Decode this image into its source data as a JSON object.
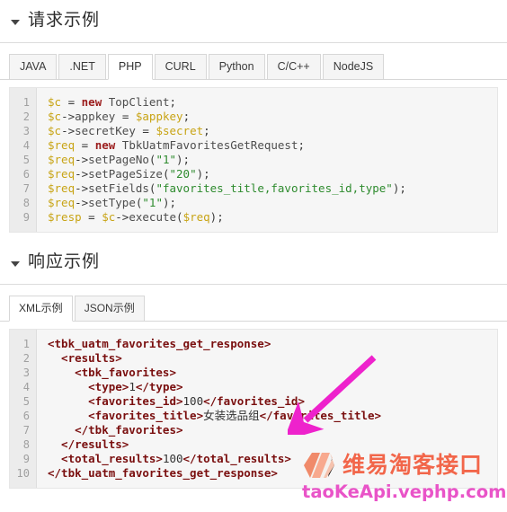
{
  "request_section": {
    "title": "请求示例",
    "caret_icon": "caret-down-icon",
    "tabs": [
      {
        "label": "JAVA",
        "active": false
      },
      {
        "label": ".NET",
        "active": false
      },
      {
        "label": "PHP",
        "active": true
      },
      {
        "label": "CURL",
        "active": false
      },
      {
        "label": "Python",
        "active": false
      },
      {
        "label": "C/C++",
        "active": false
      },
      {
        "label": "NodeJS",
        "active": false
      }
    ],
    "code": {
      "language": "php",
      "line_numbers": [
        "1",
        "2",
        "3",
        "4",
        "5",
        "6",
        "7",
        "8",
        "9"
      ],
      "lines": [
        [
          {
            "t": "$c ",
            "c": "v"
          },
          {
            "t": "= ",
            "c": "pn"
          },
          {
            "t": "new",
            "c": "kw"
          },
          {
            "t": " TopClient",
            "c": "cl"
          },
          {
            "t": ";",
            "c": "pn"
          }
        ],
        [
          {
            "t": "$c",
            "c": "v"
          },
          {
            "t": "->",
            "c": "pn"
          },
          {
            "t": "appkey ",
            "c": "cl"
          },
          {
            "t": "= ",
            "c": "pn"
          },
          {
            "t": "$appkey",
            "c": "v"
          },
          {
            "t": ";",
            "c": "pn"
          }
        ],
        [
          {
            "t": "$c",
            "c": "v"
          },
          {
            "t": "->",
            "c": "pn"
          },
          {
            "t": "secretKey ",
            "c": "cl"
          },
          {
            "t": "= ",
            "c": "pn"
          },
          {
            "t": "$secret",
            "c": "v"
          },
          {
            "t": ";",
            "c": "pn"
          }
        ],
        [
          {
            "t": "$req ",
            "c": "v"
          },
          {
            "t": "= ",
            "c": "pn"
          },
          {
            "t": "new",
            "c": "kw"
          },
          {
            "t": " TbkUatmFavoritesGetRequest",
            "c": "cl"
          },
          {
            "t": ";",
            "c": "pn"
          }
        ],
        [
          {
            "t": "$req",
            "c": "v"
          },
          {
            "t": "->",
            "c": "pn"
          },
          {
            "t": "setPageNo",
            "c": "cl"
          },
          {
            "t": "(",
            "c": "pn"
          },
          {
            "t": "\"1\"",
            "c": "st"
          },
          {
            "t": ");",
            "c": "pn"
          }
        ],
        [
          {
            "t": "$req",
            "c": "v"
          },
          {
            "t": "->",
            "c": "pn"
          },
          {
            "t": "setPageSize",
            "c": "cl"
          },
          {
            "t": "(",
            "c": "pn"
          },
          {
            "t": "\"20\"",
            "c": "st"
          },
          {
            "t": ");",
            "c": "pn"
          }
        ],
        [
          {
            "t": "$req",
            "c": "v"
          },
          {
            "t": "->",
            "c": "pn"
          },
          {
            "t": "setFields",
            "c": "cl"
          },
          {
            "t": "(",
            "c": "pn"
          },
          {
            "t": "\"favorites_title,favorites_id,type\"",
            "c": "st"
          },
          {
            "t": ");",
            "c": "pn"
          }
        ],
        [
          {
            "t": "$req",
            "c": "v"
          },
          {
            "t": "->",
            "c": "pn"
          },
          {
            "t": "setType",
            "c": "cl"
          },
          {
            "t": "(",
            "c": "pn"
          },
          {
            "t": "\"1\"",
            "c": "st"
          },
          {
            "t": ");",
            "c": "pn"
          }
        ],
        [
          {
            "t": "$resp ",
            "c": "v"
          },
          {
            "t": "= ",
            "c": "pn"
          },
          {
            "t": "$c",
            "c": "v"
          },
          {
            "t": "->",
            "c": "pn"
          },
          {
            "t": "execute",
            "c": "cl"
          },
          {
            "t": "(",
            "c": "pn"
          },
          {
            "t": "$req",
            "c": "v"
          },
          {
            "t": ");",
            "c": "pn"
          }
        ]
      ]
    }
  },
  "response_section": {
    "title": "响应示例",
    "caret_icon": "caret-down-icon",
    "tabs": [
      {
        "label": "XML示例",
        "active": true
      },
      {
        "label": "JSON示例",
        "active": false
      }
    ],
    "code": {
      "language": "xml",
      "line_numbers": [
        "1",
        "2",
        "3",
        "4",
        "5",
        "6",
        "7",
        "8",
        "9",
        "10"
      ],
      "lines": [
        [
          {
            "t": "<tbk_uatm_favorites_get_response>",
            "c": "xb"
          }
        ],
        [
          {
            "t": "  <results>",
            "c": "xb"
          }
        ],
        [
          {
            "t": "    <tbk_favorites>",
            "c": "xb"
          }
        ],
        [
          {
            "t": "      <type>",
            "c": "xb"
          },
          {
            "t": "1",
            "c": "xt"
          },
          {
            "t": "</type>",
            "c": "xb"
          }
        ],
        [
          {
            "t": "      <favorites_id>",
            "c": "xb"
          },
          {
            "t": "100",
            "c": "xt"
          },
          {
            "t": "</favorites_id>",
            "c": "xb"
          }
        ],
        [
          {
            "t": "      <favorites_title>",
            "c": "xb"
          },
          {
            "t": "女装选品组",
            "c": "xt"
          },
          {
            "t": "</favorites_title>",
            "c": "xb"
          }
        ],
        [
          {
            "t": "    </tbk_favorites>",
            "c": "xb"
          }
        ],
        [
          {
            "t": "  </results>",
            "c": "xb"
          }
        ],
        [
          {
            "t": "  <total_results>",
            "c": "xb"
          },
          {
            "t": "100",
            "c": "xt"
          },
          {
            "t": "</total_results>",
            "c": "xb"
          }
        ],
        [
          {
            "t": "</tbk_uatm_favorites_get_response>",
            "c": "xb"
          }
        ]
      ]
    }
  },
  "watermark": {
    "logo_icon": "vephp-box-logo-icon",
    "brand_cn": "维易淘客接口",
    "url": "taoKeApi.vephp.com",
    "brand_color": "#f2664a",
    "url_color": "#e954c8"
  },
  "annotation": {
    "arrow_icon": "magenta-arrow-icon",
    "color": "#ee22cc"
  }
}
